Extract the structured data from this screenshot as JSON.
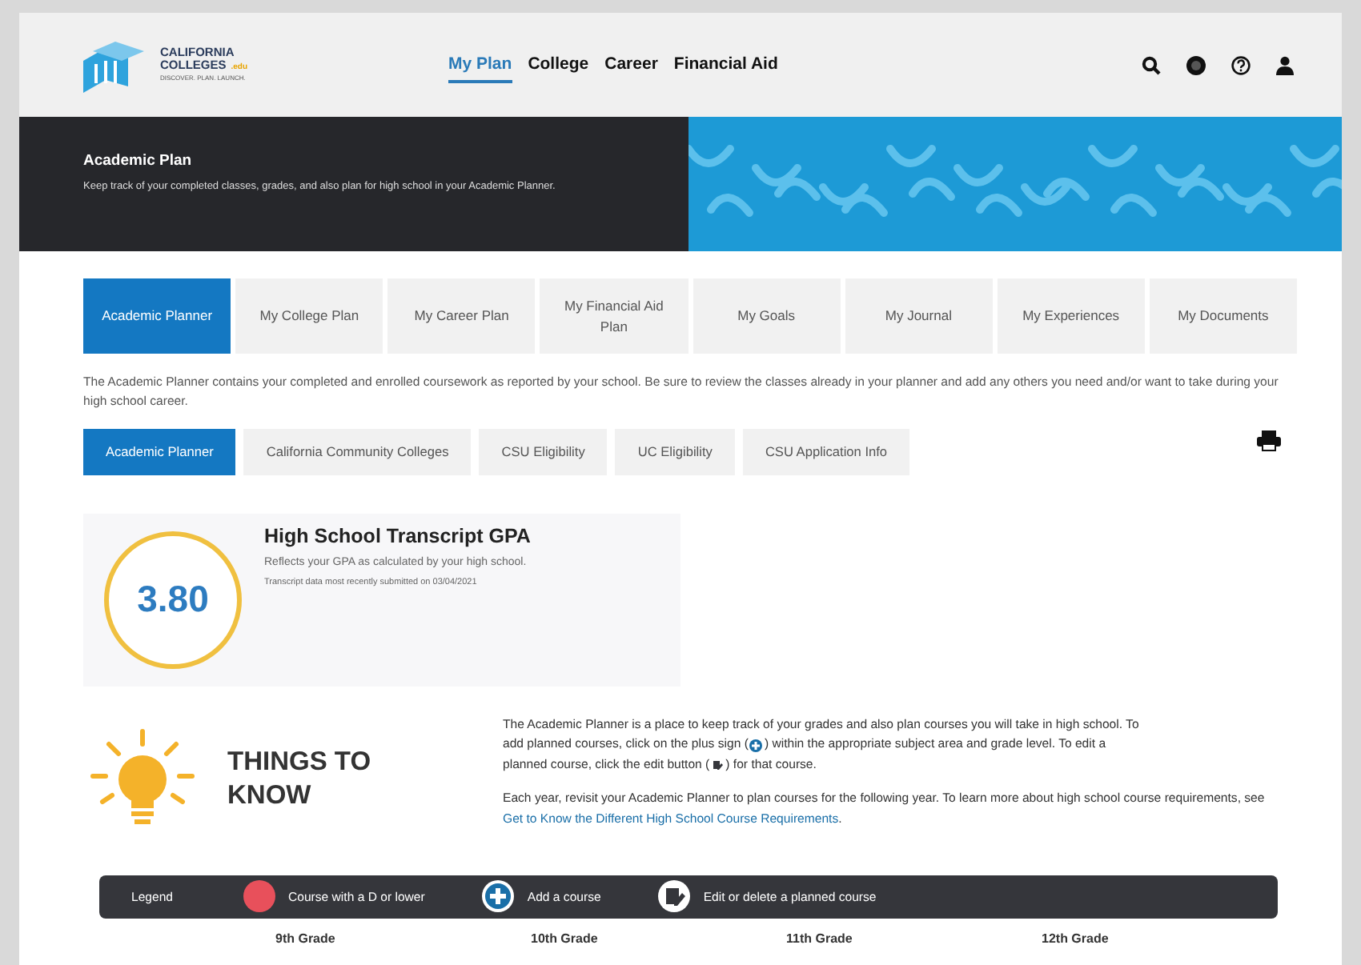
{
  "header": {
    "logo": {
      "line_1": "CALIFORNIA",
      "line_2": "COLLEGES",
      "badge": ".edu",
      "tagline": "DISCOVER. PLAN. LAUNCH."
    },
    "nav": [
      {
        "label": "My Plan",
        "selected": true
      },
      {
        "label": "College",
        "selected": false
      },
      {
        "label": "Career",
        "selected": false
      },
      {
        "label": "Financial Aid",
        "selected": false
      }
    ]
  },
  "banner": {
    "title": "Academic Plan",
    "subtitle": "Keep track of your completed classes, grades, and also plan for high school in your Academic Planner."
  },
  "tabs": [
    {
      "label": "Academic Planner",
      "selected": true
    },
    {
      "label": "My College Plan",
      "selected": false
    },
    {
      "label": "My Career Plan",
      "selected": false
    },
    {
      "label": "My Financial Aid Plan",
      "selected": false
    },
    {
      "label": "My Goals",
      "selected": false
    },
    {
      "label": "My Journal",
      "selected": false
    },
    {
      "label": "My Experiences",
      "selected": false
    },
    {
      "label": "My Documents",
      "selected": false
    }
  ],
  "intro": "The Academic Planner contains your completed and enrolled coursework as reported by your school. Be sure to review the classes already in your planner and add any others you need and/or want to take during your high school career.",
  "subtabs": [
    {
      "label": "Academic Planner",
      "selected": true
    },
    {
      "label": "California Community Colleges",
      "selected": false
    },
    {
      "label": "CSU Eligibility",
      "selected": false
    },
    {
      "label": "UC Eligibility",
      "selected": false
    },
    {
      "label": "CSU Application Info",
      "selected": false
    }
  ],
  "gpa": {
    "value": "3.80",
    "title": "High School Transcript GPA",
    "description": "Reflects your GPA as calculated by your high school.",
    "note": "Transcript data most recently submitted on 03/04/2021"
  },
  "things_to_know": {
    "title": "THINGS TO KNOW",
    "paragraph_1": [
      [
        {
          "kind": "text",
          "text": "The Academic Planner is a place to keep track of your grades and also plan courses you will take in high school. To"
        }
      ],
      [
        {
          "kind": "text",
          "text": "add planned courses, click on the plus sign ("
        },
        {
          "kind": "plus"
        },
        {
          "kind": "text",
          "text": ") within the appropriate subject area and grade level. To edit a"
        }
      ],
      [
        {
          "kind": "text",
          "text": "planned course, click the edit button ("
        },
        {
          "kind": "edit"
        },
        {
          "kind": "text",
          "text": ") for that course."
        }
      ]
    ],
    "paragraph_2": "Each year, revisit your Academic Planner to plan courses for the following year. To learn more about high school course requirements, see",
    "link": "Get to Know the Different High School Course Requirements",
    "after_link": "."
  },
  "legend": {
    "label": "Legend",
    "items": [
      {
        "kind": "dot",
        "label": "Course with a D or lower"
      },
      {
        "kind": "plus",
        "label": "Add a course"
      },
      {
        "kind": "edit",
        "label": "Edit or delete a planned course"
      }
    ]
  },
  "grades": [
    "9th Grade",
    "10th Grade",
    "11th Grade",
    "12th Grade"
  ]
}
